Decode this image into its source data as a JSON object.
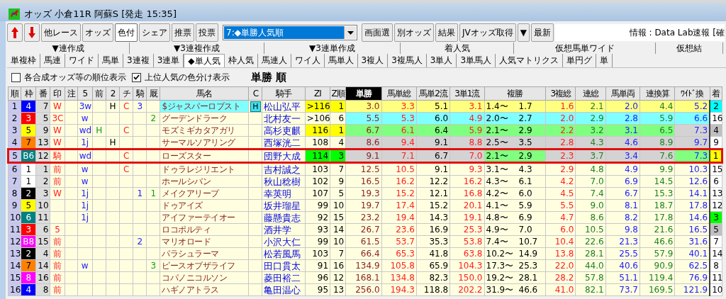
{
  "window": {
    "title": "オッズ 小倉11R 阿蘇S  [発走 15:35]"
  },
  "toolbar": {
    "buttons": [
      {
        "label": "他レース",
        "pressed": false
      },
      {
        "label": "オッズ",
        "pressed": false
      },
      {
        "label": "色付",
        "pressed": true
      },
      {
        "label": "シェア",
        "pressed": false
      },
      {
        "label": "推票",
        "pressed": false
      },
      {
        "label": "投票",
        "pressed": false
      }
    ],
    "view_select": {
      "value": "7:◆単勝人気順"
    },
    "buttons_right": [
      {
        "label": "画面選",
        "pressed": false
      },
      {
        "label": "別オッズ",
        "pressed": false
      },
      {
        "label": "結果",
        "pressed": false
      },
      {
        "label": "JVオッズ取得",
        "pressed": false
      },
      {
        "label": "▼",
        "pressed": false
      },
      {
        "label": "最新",
        "pressed": false
      }
    ],
    "info": "情報 : Data Lab速報 [確"
  },
  "tab_groups": [
    "▼連作成",
    "▼3連複作成",
    "▼3連単作成",
    "着人気",
    "仮想馬単ワイド",
    "仮想結"
  ],
  "tabs": [
    {
      "label": "単複枠",
      "selected": false
    },
    {
      "label": "馬連",
      "selected": false
    },
    {
      "label": "ワイド",
      "selected": false
    },
    {
      "label": "馬単",
      "selected": false
    },
    {
      "label": "3連複",
      "selected": false
    },
    {
      "label": "3連単",
      "selected": false
    },
    {
      "label": "◆単人気",
      "selected": true
    },
    {
      "label": "枠人気",
      "selected": false
    },
    {
      "label": "馬連人",
      "selected": false
    },
    {
      "label": "ワイ人",
      "selected": false
    },
    {
      "label": "馬単人",
      "selected": false
    },
    {
      "label": "3複人",
      "selected": false
    },
    {
      "label": "3複馬人",
      "selected": false
    },
    {
      "label": "3単人",
      "selected": false
    },
    {
      "label": "3単馬人",
      "selected": false
    },
    {
      "label": "人気マトリクス",
      "selected": false
    },
    {
      "label": "単円グ",
      "selected": false
    },
    {
      "label": "単",
      "selected": false
    }
  ],
  "options": [
    {
      "label": "各合成オッズ等の順位表示",
      "checked": false
    },
    {
      "label": "上位人気の色分け表示",
      "checked": true
    }
  ],
  "sort_label": "単勝 順",
  "table": {
    "columns": [
      {
        "label": "順",
        "sorted": false
      },
      {
        "label": "枠",
        "sorted": false
      },
      {
        "label": "番",
        "sorted": false
      },
      {
        "label": "印",
        "sorted": false
      },
      {
        "label": "注",
        "sorted": false
      },
      {
        "label": "5",
        "sorted": false
      },
      {
        "label": "前",
        "sorted": false
      },
      {
        "label": "2",
        "sorted": false
      },
      {
        "label": "チ",
        "sorted": false
      },
      {
        "label": "騎",
        "sorted": false
      },
      {
        "label": "厩",
        "sorted": false
      },
      {
        "label": "馬名",
        "sorted": false
      },
      {
        "label": "C",
        "sorted": false
      },
      {
        "label": "騎手",
        "sorted": false
      },
      {
        "label": "ZI",
        "sorted": false
      },
      {
        "label": "Z順",
        "sorted": false
      },
      {
        "label": "単勝",
        "sorted": true
      },
      {
        "label": "馬単総",
        "sorted": false
      },
      {
        "label": "馬単2流",
        "sorted": false
      },
      {
        "label": "3単1流",
        "sorted": false
      },
      {
        "label": "複勝",
        "sorted": false
      },
      {
        "label": "3複総",
        "sorted": false
      },
      {
        "label": "連総",
        "sorted": false
      },
      {
        "label": "馬単両",
        "sorted": false
      },
      {
        "label": "連換算",
        "sorted": false
      },
      {
        "label": "ﾜｲﾄﾞ換",
        "sorted": false
      },
      {
        "label": "着",
        "sorted": false
      }
    ],
    "rows": [
      {
        "rank": "1",
        "waku": {
          "label": "4",
          "color": "#0000ff"
        },
        "num": "7",
        "marks": {
          "shirushi": "W",
          "go": "3w",
          "ni": "H",
          "chi": "C",
          "ki": "3"
        },
        "name": {
          "text": "$ジャスパーロブスト",
          "color": "#80ffff"
        },
        "c": "H",
        "jockey": "松山弘平",
        "zi": {
          "value": ">116",
          "color": "#ffff00"
        },
        "z_rank": "1",
        "color": "#ffff80",
        "odds": [
          "3.0",
          "3.3",
          "5.1",
          "3.1"
        ],
        "fuku": {
          "low": "1.4〜",
          "high": "1.7"
        },
        "odds2": [
          "1.6",
          "2.1",
          "2.0",
          "4.4"
        ],
        "wide": {
          "value": "5.2"
        },
        "finish": {
          "value": "2",
          "color": "#00ffff"
        },
        "selected": false
      },
      {
        "rank": "2",
        "waku": {
          "label": "3",
          "color": "#ff0000"
        },
        "num": "5",
        "marks": {
          "shirushi": "3C",
          "go": "w",
          "kyu": "2"
        },
        "name": {
          "text": "グーデンドラーク"
        },
        "jockey": "北村友一",
        "zi": {
          "value": ">106"
        },
        "z_rank": "6",
        "color": "#80ffff",
        "odds": [
          "5.5",
          "5.3",
          "6.0",
          "4.9"
        ],
        "fuku": {
          "low": "2.0〜",
          "high": "2.7"
        },
        "odds2": [
          "2.0",
          "2.9",
          "2.8",
          "5.9"
        ],
        "wide": {
          "value": "6.6"
        },
        "finish": {
          "value": "16"
        },
        "selected": false
      },
      {
        "rank": "3",
        "waku": {
          "label": "5",
          "color": "#ffff00"
        },
        "num": "9",
        "marks": {
          "shirushi": "W",
          "go": "wd",
          "mae": "H",
          "chi": "C"
        },
        "name": {
          "text": "モズミギカタアガリ"
        },
        "jockey": "高杉吏麒",
        "zi": {
          "value": "116",
          "color": "#ffff00"
        },
        "z_rank": "1",
        "color": "#80ff80",
        "odds": [
          "6.7",
          "6.1",
          "6.4",
          "5.9"
        ],
        "fuku": {
          "low": "2.1〜",
          "high": "2.9"
        },
        "odds2": [
          "2.2",
          "3.2",
          "3.1",
          "6.5"
        ],
        "wide": {
          "value": "7.3",
          "color": "#d3d3d3"
        },
        "finish": {
          "value": "4",
          "color": "#c0c0c0"
        },
        "selected": false
      },
      {
        "rank": "4",
        "waku": {
          "label": "7",
          "color": "#ff8000"
        },
        "num": "13",
        "marks": {
          "shirushi": "W",
          "go": "1j",
          "ni": "H"
        },
        "name": {
          "text": "サーマルソアリング"
        },
        "jockey": "西塚洸二",
        "zi": {
          "value": "108"
        },
        "z_rank": "4",
        "color": "#d3d3d3",
        "odds": [
          "8.6",
          "9.4",
          "9.1",
          "8.8"
        ],
        "fuku": {
          "low": "2.5〜",
          "high": "3.5"
        },
        "odds2": [
          "2.8",
          "4.3",
          "4.6",
          "8.9"
        ],
        "wide": {
          "value": "9.7"
        },
        "finish": {
          "value": "9"
        },
        "selected": false
      },
      {
        "rank": "5",
        "waku": {
          "label": "B6",
          "color": "#008080"
        },
        "num": "12",
        "marks": {
          "shirushi": "騎",
          "go": "wd",
          "chi": "C"
        },
        "name": {
          "text": "ローズスター"
        },
        "jockey": "団野大成",
        "zi": {
          "value": "114",
          "color": "#00ff00"
        },
        "z_rank": "3",
        "color": "#d3d3d3",
        "odds": [
          "9.1",
          "7.1",
          "6.7",
          "7.0"
        ],
        "fuku": {
          "low": "2.1〜",
          "high": "2.9",
          "color": "#80ff80"
        },
        "odds2": [
          "2.3",
          "3.7",
          "3.4",
          "7.6"
        ],
        "wide": {
          "value": "7.3",
          "color": "#80ff80"
        },
        "finish": {
          "value": "1",
          "color": "#ffff00"
        },
        "selected": true
      },
      {
        "rank": "6",
        "waku": {
          "label": "1",
          "color": "#ffffff"
        },
        "num": "1",
        "marks": {
          "shirushi": "前",
          "go": "w",
          "chi": "C"
        },
        "name": {
          "text": "ドゥラレジリエント"
        },
        "jockey": "吉村誠之",
        "zi": {
          "value": "103"
        },
        "z_rank": "7",
        "odds": [
          "12.5",
          "10.5",
          "9.1",
          "9.3"
        ],
        "fuku": {
          "low": "3.1〜",
          "high": "4.3"
        },
        "odds2": [
          "2.9",
          "4.8",
          "4.9",
          "9.9"
        ],
        "wide": {
          "value": "10.3"
        },
        "finish": {
          "value": "15"
        },
        "selected": false
      },
      {
        "rank": "7",
        "waku": {
          "label": "1",
          "color": "#ffffff"
        },
        "num": "2",
        "marks": {
          "shirushi": "前",
          "go": "w"
        },
        "name": {
          "text": "ホールシバン"
        },
        "jockey": "秋山稔樹",
        "zi": {
          "value": "102"
        },
        "z_rank": "9",
        "odds": [
          "16.5",
          "16.2",
          "12.2",
          "16.2"
        ],
        "fuku": {
          "low": "4.3〜",
          "high": "6.1"
        },
        "odds2": [
          "4.2",
          "7.0",
          "6.9",
          "14.5"
        ],
        "wide": {
          "value": "12.6"
        },
        "finish": {
          "value": "6"
        },
        "selected": false
      },
      {
        "rank": "8",
        "waku": {
          "label": "2",
          "color": "#000000"
        },
        "num": "3",
        "marks": {
          "shirushi": "W",
          "go": "1j",
          "ki": "1",
          "kyu": "1"
        },
        "name": {
          "text": "メイクアリープ"
        },
        "jockey": "幸英明",
        "zi": {
          "value": "107"
        },
        "z_rank": "5",
        "odds": [
          "19.3",
          "15.2",
          "12.1",
          "16.8"
        ],
        "fuku": {
          "low": "4.2〜",
          "high": "6.0"
        },
        "odds2": [
          "4.5",
          "7.4",
          "6.7",
          "15.3"
        ],
        "wide": {
          "value": "14.1"
        },
        "finish": {
          "value": "13"
        },
        "selected": false
      },
      {
        "rank": "9",
        "waku": {
          "label": "5",
          "color": "#ffff00"
        },
        "num": "10",
        "marks": {
          "go": "1j"
        },
        "name": {
          "text": "ドゥアイズ"
        },
        "jockey": "坂井瑠星",
        "zi": {
          "value": "99"
        },
        "z_rank": "10",
        "odds": [
          "19.7",
          "17.4",
          "15.2",
          "20.1"
        ],
        "fuku": {
          "low": "4.1〜",
          "high": "5.9"
        },
        "odds2": [
          "5.5",
          "9.0",
          "8.1",
          "18.7"
        ],
        "wide": {
          "value": "17.8"
        },
        "finish": {
          "value": "12"
        },
        "selected": false
      },
      {
        "rank": "10",
        "waku": {
          "label": "6",
          "color": "#008080"
        },
        "num": "11",
        "marks": {
          "go": "1j"
        },
        "name": {
          "text": "アイファーテイオー"
        },
        "jockey": "藤懸貴志",
        "zi": {
          "value": "92"
        },
        "z_rank": "15",
        "odds": [
          "23.2",
          "19.4",
          "14.3",
          "19.1"
        ],
        "fuku": {
          "low": "4.8〜",
          "high": "6.9"
        },
        "odds2": [
          "4.7",
          "8.6",
          "8.2",
          "17.8"
        ],
        "wide": {
          "value": "14.6"
        },
        "finish": {
          "value": "3",
          "color": "#00ff00"
        },
        "selected": false
      },
      {
        "rank": "11",
        "waku": {
          "label": "3",
          "color": "#ff0000"
        },
        "num": "6",
        "marks": {
          "shirushi": "5"
        },
        "name": {
          "text": "ロコポルティ"
        },
        "jockey": "酒井学",
        "zi": {
          "value": "93"
        },
        "z_rank": "14",
        "odds": [
          "26.7",
          "23.6",
          "16.9",
          "25.3"
        ],
        "fuku": {
          "low": "4.9〜",
          "high": "7.0"
        },
        "odds2": [
          "6.0",
          "10.5",
          "9.8",
          "21.6"
        ],
        "wide": {
          "value": "16.5"
        },
        "finish": {
          "value": "5",
          "color": "#c0c0c0"
        },
        "selected": false
      },
      {
        "rank": "12",
        "waku": {
          "label": "B8",
          "color": "#ff00ff"
        },
        "num": "15",
        "marks": {
          "shirushi": "前",
          "ki": "2"
        },
        "name": {
          "text": "マリオロード"
        },
        "jockey": "小沢大仁",
        "zi": {
          "value": "99"
        },
        "z_rank": "10",
        "odds": [
          "61.5",
          "53.7",
          "35.3",
          "53.8"
        ],
        "fuku": {
          "low": "7.4〜",
          "high": "10.7"
        },
        "odds2": [
          "10.4",
          "22.6",
          "21.3",
          "46.6"
        ],
        "wide": {
          "value": "31.6"
        },
        "finish": {
          "value": "7"
        },
        "selected": false
      },
      {
        "rank": "13",
        "waku": {
          "label": "2",
          "color": "#000000"
        },
        "num": "4",
        "marks": {
          "shirushi": "前"
        },
        "name": {
          "text": "パラシュラーマ"
        },
        "jockey": "松若風馬",
        "zi": {
          "value": "103"
        },
        "z_rank": "7",
        "odds": [
          "66.4",
          "65.3",
          "41.8",
          "63.8"
        ],
        "fuku": {
          "low": "10.2〜",
          "high": "14.9"
        },
        "odds2": [
          "13.8",
          "28.1",
          "25.5",
          "57.9"
        ],
        "wide": {
          "value": "40.1"
        },
        "finish": {
          "value": "14"
        },
        "selected": false
      },
      {
        "rank": "14",
        "waku": {
          "label": "7",
          "color": "#ff8000"
        },
        "num": "14",
        "marks": {
          "shirushi": "前",
          "go": "w",
          "kyu": "3"
        },
        "name": {
          "text": "ピースオブザライフ"
        },
        "jockey": "田口貫太",
        "zi": {
          "value": "91"
        },
        "z_rank": "16",
        "odds": [
          "134.9",
          "105.8",
          "65.9",
          "104.3"
        ],
        "fuku": {
          "low": "17.3〜",
          "high": "25.3"
        },
        "odds2": [
          "22.0",
          "44.0",
          "40.6",
          "90.9"
        ],
        "wide": {
          "value": "62.5"
        },
        "finish": {
          "value": "8"
        },
        "selected": false
      },
      {
        "rank": "15",
        "waku": {
          "label": "8",
          "color": "#ff00ff"
        },
        "num": "16",
        "marks": {
          "shirushi": "前"
        },
        "name": {
          "text": "コパノニコルソン"
        },
        "jockey": "菱田裕二",
        "zi": {
          "value": "96"
        },
        "z_rank": "12",
        "odds": [
          "168.1",
          "134.8",
          "82.3",
          "150.0"
        ],
        "fuku": {
          "low": "19.2〜",
          "high": "28.1"
        },
        "odds2": [
          "28.2",
          "57.8",
          "51.1",
          "119.4"
        ],
        "wide": {
          "value": "76.9"
        },
        "finish": {
          "value": "11"
        },
        "selected": false
      },
      {
        "rank": "16",
        "waku": {
          "label": "4",
          "color": "#0000ff"
        },
        "num": "8",
        "marks": {
          "shirushi": "前"
        },
        "name": {
          "text": "ハギノアトラス"
        },
        "jockey": "亀田温心",
        "zi": {
          "value": "95"
        },
        "z_rank": "13",
        "odds": [
          "256.0",
          "194.3",
          "118.8",
          "202.2"
        ],
        "fuku": {
          "low": "31.9〜",
          "high": "46.6"
        },
        "odds2": [
          "41.0",
          "82.1",
          "73.7",
          "169.5"
        ],
        "wide": {
          "value": "121.9"
        },
        "finish": {
          "value": "10"
        },
        "selected": false
      }
    ]
  }
}
